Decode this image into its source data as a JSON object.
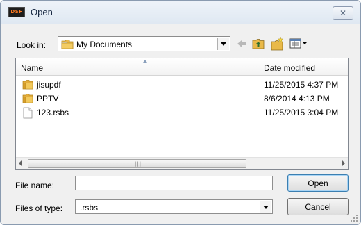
{
  "window": {
    "title": "Open",
    "app_icon_text": "DSF",
    "close_glyph": "✕",
    "app_icon_color": "#ff7a22"
  },
  "toolbar": {
    "lookin_label": "Look in:",
    "lookin_value": "My Documents",
    "lookin_icon": "folder-icon",
    "back_icon": "back-arrow-icon",
    "up_icon": "up-folder-icon",
    "new_folder_icon": "new-folder-icon",
    "view_menu_icon": "view-menu-icon"
  },
  "filelist": {
    "columns": {
      "name": "Name",
      "date_modified": "Date modified"
    },
    "rows": [
      {
        "name": "jisupdf",
        "date": "11/25/2015 4:37 PM",
        "icon": "folder-icon"
      },
      {
        "name": "PPTV",
        "date": "8/6/2014 4:13 PM",
        "icon": "folder-icon"
      },
      {
        "name": "123.rsbs",
        "date": "11/25/2015 3:04 PM",
        "icon": "file-icon"
      }
    ]
  },
  "form": {
    "file_name_label": "File name:",
    "file_name_value": "",
    "files_of_type_label": "Files of type:",
    "files_of_type_value": ".rsbs"
  },
  "buttons": {
    "open_label": "Open",
    "cancel_label": "Cancel"
  }
}
